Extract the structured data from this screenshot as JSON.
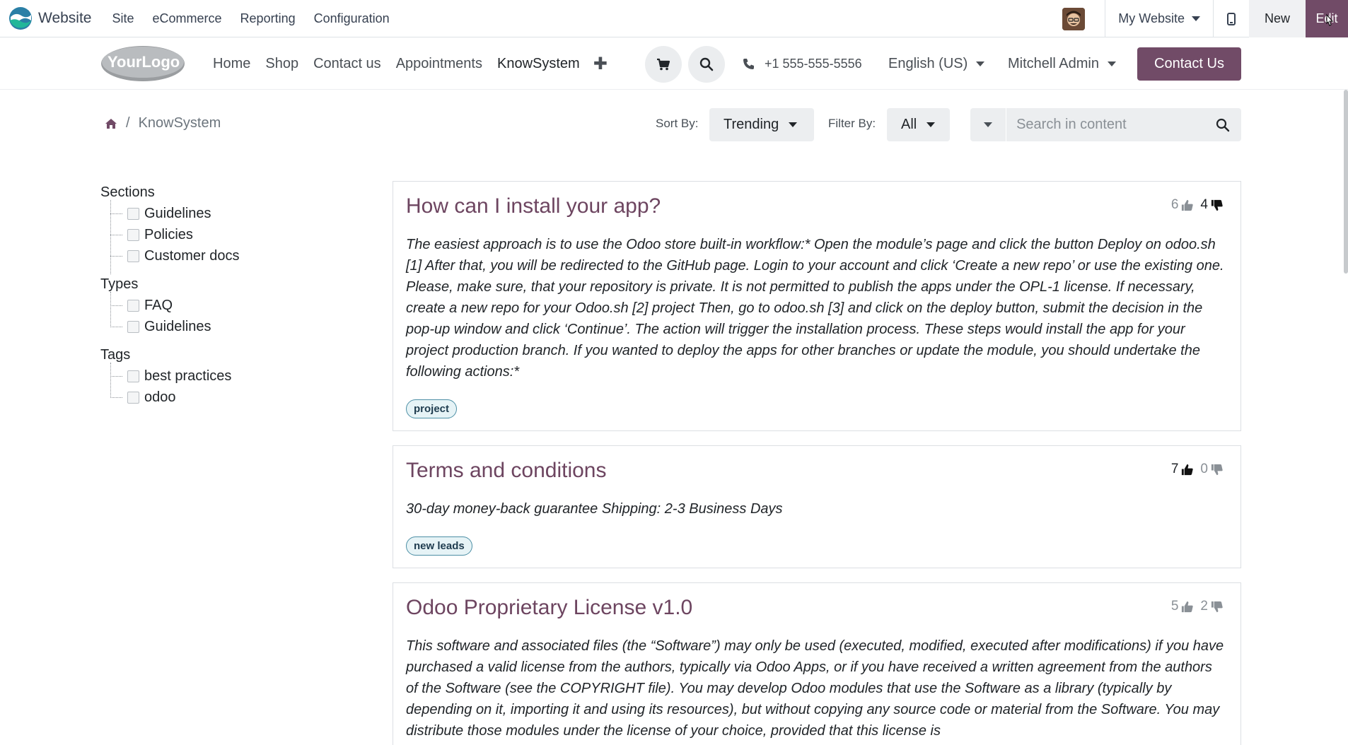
{
  "adminbar": {
    "app_name": "Website",
    "menus": [
      "Site",
      "eCommerce",
      "Reporting",
      "Configuration"
    ],
    "website_selector": "My Website",
    "new_label": "New",
    "edit_label": "Edit"
  },
  "navbar": {
    "logo_text": "YourLogo",
    "links": [
      "Home",
      "Shop",
      "Contact us",
      "Appointments",
      "KnowSystem"
    ],
    "active_link": "KnowSystem",
    "phone": "+1 555-555-5556",
    "language": "English (US)",
    "user": "Mitchell Admin",
    "contact_button": "Contact Us"
  },
  "toolbar": {
    "breadcrumb_current": "KnowSystem",
    "sort_label": "Sort By:",
    "sort_value": "Trending",
    "filter_label": "Filter By:",
    "filter_value": "All",
    "search_placeholder": "Search in content"
  },
  "sidebar": {
    "sections": {
      "title": "Sections",
      "items": [
        "Guidelines",
        "Policies",
        "Customer docs"
      ]
    },
    "types": {
      "title": "Types",
      "items": [
        "FAQ",
        "Guidelines"
      ]
    },
    "tags": {
      "title": "Tags",
      "items": [
        "best practices",
        "odoo"
      ]
    }
  },
  "articles": [
    {
      "title": "How can I install your app?",
      "likes": "6",
      "dislikes": "4",
      "body": "The easiest approach is to use the Odoo store built-in workflow:* Open the module’s page and click the button Deploy on odoo.sh [1] After that, you will be redirected to the GitHub page. Login to your account and click ‘Create a new repo’ or use the existing one. Please, make sure, that your repository is private. It is not permitted to publish the apps under the OPL-1 license. If necessary, create a new repo for your Odoo.sh [2] project Then, go to odoo.sh [3] and click on the deploy button, submit the decision in the pop-up window and click ‘Continue’. The action will trigger the installation process. These steps would install the app for your project production branch. If you wanted to deploy the apps for other branches or update the module, you should undertake the following actions:*",
      "tag": "project"
    },
    {
      "title": "Terms and conditions",
      "likes": "7",
      "dislikes": "0",
      "body": "30-day money-back guarantee Shipping: 2-3 Business Days",
      "tag": "new leads"
    },
    {
      "title": "Odoo Proprietary License v1.0",
      "likes": "5",
      "dislikes": "2",
      "body": "This software and associated files (the “Software”) may only be used (executed, modified, executed after modifications) if you have purchased a valid license from the authors, typically via Odoo Apps, or if you have received a written agreement from the authors of the Software (see the COPYRIGHT file). You may develop Odoo modules that use the Software as a library (typically by depending on it, importing it and using its resources), but without copying any source code or material from the Software. You may distribute those modules under the license of your choice, provided that this license is"
    }
  ],
  "colors": {
    "brand": "#714b67",
    "title": "#6d4560",
    "tag_border": "#4c8fa5"
  }
}
